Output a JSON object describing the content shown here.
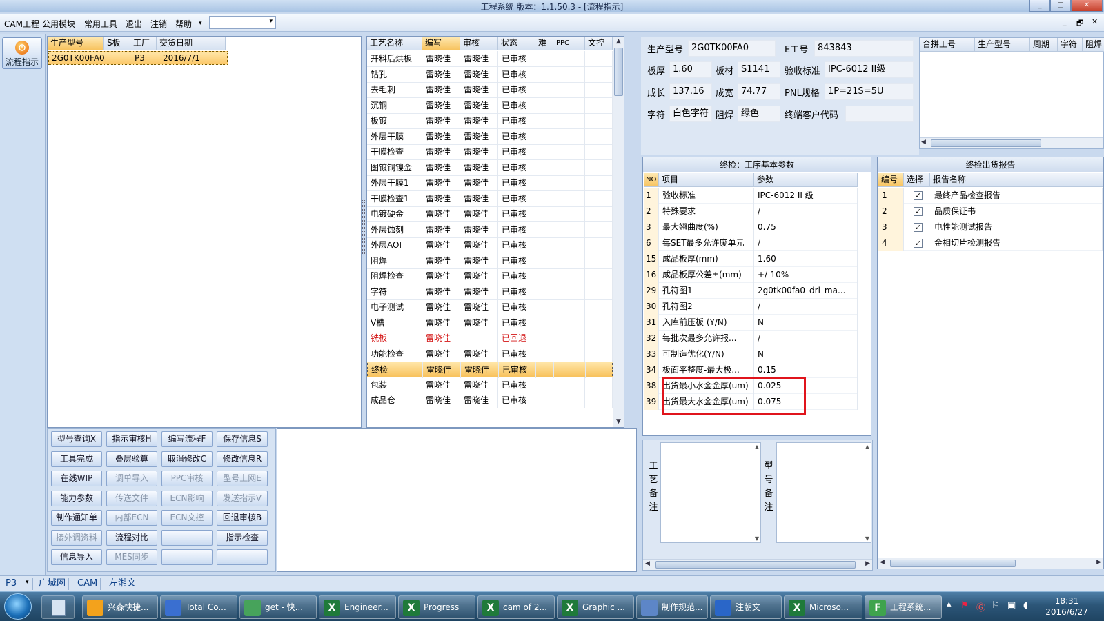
{
  "window": {
    "title": "工程系统   版本：1.1.50.3 - [流程指示]",
    "controls": [
      "_",
      "□",
      "✕"
    ]
  },
  "menubar": {
    "items": [
      "CAM工程",
      "公用模块",
      "常用工具",
      "退出",
      "注销",
      "帮助"
    ],
    "mdi_controls": [
      "_",
      "🗗",
      "✕"
    ]
  },
  "leftnav": {
    "flow_label": "流程指示"
  },
  "orders": {
    "headers": [
      "生产型号",
      "S板",
      "工厂",
      "交货日期"
    ],
    "rows": [
      [
        "2G0TK00FA0",
        "",
        "P3",
        "2016/7/1"
      ]
    ]
  },
  "process": {
    "headers": [
      "工艺名称",
      "编写",
      "审核",
      "状态",
      "难",
      "PPC",
      "文控"
    ],
    "rows": [
      [
        "开料后烘板",
        "雷晓佳",
        "雷晓佳",
        "已审核"
      ],
      [
        "钻孔",
        "雷晓佳",
        "雷晓佳",
        "已审核"
      ],
      [
        "去毛刺",
        "雷晓佳",
        "雷晓佳",
        "已审核"
      ],
      [
        "沉铜",
        "雷晓佳",
        "雷晓佳",
        "已审核"
      ],
      [
        "板镀",
        "雷晓佳",
        "雷晓佳",
        "已审核"
      ],
      [
        "外层干膜",
        "雷晓佳",
        "雷晓佳",
        "已审核"
      ],
      [
        "干膜检查",
        "雷晓佳",
        "雷晓佳",
        "已审核"
      ],
      [
        "图镀铜镍金",
        "雷晓佳",
        "雷晓佳",
        "已审核"
      ],
      [
        "外层干膜1",
        "雷晓佳",
        "雷晓佳",
        "已审核"
      ],
      [
        "干膜检查1",
        "雷晓佳",
        "雷晓佳",
        "已审核"
      ],
      [
        "电镀硬金",
        "雷晓佳",
        "雷晓佳",
        "已审核"
      ],
      [
        "外层蚀刻",
        "雷晓佳",
        "雷晓佳",
        "已审核"
      ],
      [
        "外层AOI",
        "雷晓佳",
        "雷晓佳",
        "已审核"
      ],
      [
        "阻焊",
        "雷晓佳",
        "雷晓佳",
        "已审核"
      ],
      [
        "阻焊检查",
        "雷晓佳",
        "雷晓佳",
        "已审核"
      ],
      [
        "字符",
        "雷晓佳",
        "雷晓佳",
        "已审核"
      ],
      [
        "电子测试",
        "雷晓佳",
        "雷晓佳",
        "已审核"
      ],
      [
        "V槽",
        "雷晓佳",
        "雷晓佳",
        "已审核"
      ],
      [
        "铣板",
        "雷晓佳",
        "",
        "已回退"
      ],
      [
        "功能检查",
        "雷晓佳",
        "雷晓佳",
        "已审核"
      ],
      [
        "终检",
        "雷晓佳",
        "雷晓佳",
        "已审核"
      ],
      [
        "包装",
        "雷晓佳",
        "雷晓佳",
        "已审核"
      ],
      [
        "成品仓",
        "雷晓佳",
        "雷晓佳",
        "已审核"
      ]
    ],
    "active_row": "终检",
    "returned_row": "铣板",
    "returned_color": "#d41414"
  },
  "buttons": [
    [
      "型号查询X",
      "指示审核H",
      "编写流程F",
      "保存信息S"
    ],
    [
      "工具完成",
      "叠层验算",
      "取消修改C",
      "修改信息R"
    ],
    [
      "在线WIP",
      "调单导入",
      "PPC审核",
      "型号上网E"
    ],
    [
      "能力参数",
      "传送文件",
      "ECN影响",
      "发送指示V"
    ],
    [
      "制作通知单",
      "内部ECN",
      "ECN文控",
      "回退审核B"
    ],
    [
      "接外调资料",
      "流程对比",
      "",
      "指示检查"
    ],
    [
      "信息导入",
      "MES同步",
      "",
      ""
    ]
  ],
  "disabled_buttons": [
    "调单导入",
    "PPC审核",
    "型号上网E",
    "传送文件",
    "ECN影响",
    "发送指示V",
    "内部ECN",
    "ECN文控",
    "接外调资料",
    "MES同步"
  ],
  "info": {
    "model_label": "生产型号",
    "model": "2G0TK00FA0",
    "eno_label": "E工号",
    "eno": "843843",
    "thick_label": "板厚",
    "thick": "1.60",
    "material_label": "板材",
    "material": "S1141",
    "std_label": "验收标准",
    "std": "IPC-6012 II级",
    "len_label": "成长",
    "len": "137.16",
    "wid_label": "成宽",
    "wid": "74.77",
    "pnl_label": "PNL规格",
    "pnl": "1P=21S=5U",
    "char_label": "字符",
    "char": "白色字符",
    "mask_label": "阻焊",
    "mask": "绿色",
    "cust_label": "终端客户代码",
    "cust": ""
  },
  "merge": {
    "headers": [
      "合拼工号",
      "生产型号",
      "周期",
      "字符",
      "阻焊"
    ]
  },
  "params": {
    "title": "终检：工序基本参数",
    "headers": [
      "NO",
      "项目",
      "参数"
    ],
    "rows": [
      [
        "1",
        "验收标准",
        "IPC-6012 II 级"
      ],
      [
        "2",
        "特殊要求",
        "/"
      ],
      [
        "3",
        "最大翘曲度(%)",
        "0.75"
      ],
      [
        "6",
        "每SET最多允许废单元",
        "/"
      ],
      [
        "15",
        "成品板厚(mm)",
        "1.60"
      ],
      [
        "16",
        "成品板厚公差±(mm)",
        "+/-10%"
      ],
      [
        "29",
        "孔符图1",
        "2g0tk00fa0_drl_ma..."
      ],
      [
        "30",
        "孔符图2",
        "/"
      ],
      [
        "31",
        "入库前压板 (Y/N)",
        "N"
      ],
      [
        "32",
        "每批次最多允许报...",
        "/"
      ],
      [
        "33",
        "可制造优化(Y/N)",
        "N"
      ],
      [
        "34",
        "板面平整度-最大极...",
        "0.15"
      ],
      [
        "38",
        "出货最小水金金厚(um)",
        "0.025"
      ],
      [
        "39",
        "出货最大水金金厚(um)",
        "0.075"
      ]
    ]
  },
  "report": {
    "title": "终检出货报告",
    "headers": [
      "编号",
      "选择",
      "报告名称"
    ],
    "rows": [
      [
        "1",
        "✓",
        "最终产品检查报告"
      ],
      [
        "2",
        "✓",
        "品质保证书"
      ],
      [
        "3",
        "✓",
        "电性能测试报告"
      ],
      [
        "4",
        "✓",
        "金相切片检测报告"
      ]
    ]
  },
  "notes": {
    "process_label": "工艺备注",
    "model_label": "型号备注"
  },
  "statusbar": {
    "items": [
      "P3",
      "广域网",
      "CAM",
      "左湘文"
    ]
  },
  "taskbar": {
    "items": [
      {
        "label": "兴森快捷...",
        "icon": "shell-icon",
        "color": "#f3a21c"
      },
      {
        "label": "Total Co...",
        "icon": "floppy-icon",
        "color": "#3a6fd0"
      },
      {
        "label": "get - 快...",
        "icon": "eye-icon",
        "color": "#47a35b"
      },
      {
        "label": "Engineer...",
        "icon": "excel-icon",
        "color": "#1f7a3a"
      },
      {
        "label": "Progress",
        "icon": "excel-icon",
        "color": "#1f7a3a"
      },
      {
        "label": "cam of 2...",
        "icon": "excel-icon",
        "color": "#1f7a3a"
      },
      {
        "label": "Graphic ...",
        "icon": "excel-icon",
        "color": "#1f7a3a"
      },
      {
        "label": "制作规范...",
        "icon": "doc-icon",
        "color": "#5d86c7"
      },
      {
        "label": "注朝文",
        "icon": "foxmail-icon",
        "color": "#2a66c8"
      },
      {
        "label": "Microso...",
        "icon": "excel-icon",
        "color": "#1f7a3a"
      },
      {
        "label": "工程系统...",
        "icon": "app-icon",
        "color": "#3fa34d"
      }
    ],
    "time": "18:31",
    "date": "2016/6/27"
  }
}
